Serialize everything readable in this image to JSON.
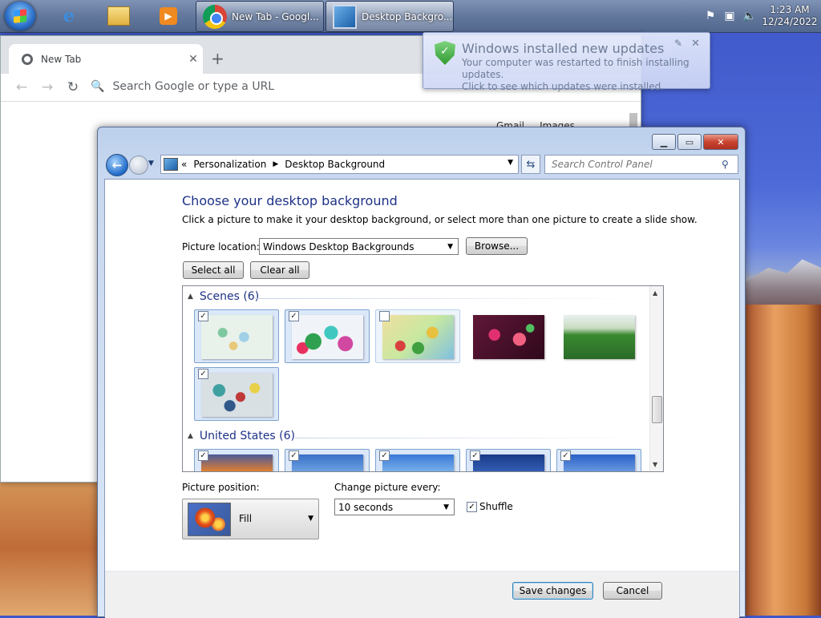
{
  "taskbar": {
    "tasks": [
      {
        "label": "New Tab - Googl..."
      },
      {
        "label": "Desktop Backgro..."
      }
    ],
    "clock_time": "1:23 AM",
    "clock_date": "12/24/2022"
  },
  "chrome": {
    "tab_title": "New Tab",
    "omnibox_placeholder": "Search Google or type a URL",
    "link_gmail": "Gmail",
    "link_images": "Images"
  },
  "notification": {
    "title": "Windows installed new updates",
    "line1": "Your computer was restarted to finish installing updates.",
    "line2": "Click to see which updates were installed."
  },
  "window": {
    "breadcrumb": [
      "Personalization",
      "Desktop Background"
    ],
    "search_placeholder": "Search Control Panel",
    "heading": "Choose your desktop background",
    "subtext": "Click a picture to make it your desktop background, or select more than one picture to create a slide show.",
    "picture_location_label": "Picture location:",
    "picture_location_value": "Windows Desktop Backgrounds",
    "browse_label": "Browse...",
    "select_all_label": "Select all",
    "clear_all_label": "Clear all",
    "groups": [
      {
        "title": "Scenes (6)",
        "checked": [
          true,
          true,
          false,
          false,
          false,
          true
        ]
      },
      {
        "title": "United States (6)",
        "checked": [
          true,
          true,
          true,
          true,
          true
        ]
      }
    ],
    "picture_position_label": "Picture position:",
    "picture_position_value": "Fill",
    "change_every_label": "Change picture every:",
    "change_every_value": "10 seconds",
    "shuffle_label": "Shuffle",
    "shuffle_checked": true,
    "save_label": "Save changes",
    "cancel_label": "Cancel"
  }
}
